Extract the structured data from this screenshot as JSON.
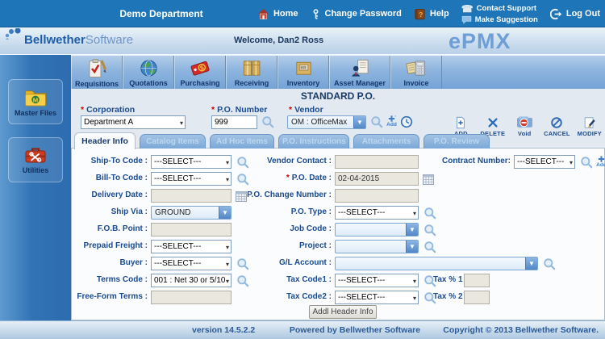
{
  "topbar": {
    "department": "Demo Department",
    "home": "Home",
    "change_password": "Change Password",
    "help": "Help",
    "contact_support": "Contact Support",
    "make_suggestion": "Make Suggestion",
    "log_out": "Log Out"
  },
  "welcome_bar": {
    "brand_bold": "Bellwether",
    "brand_light": "Software",
    "welcome": "Welcome, Dan2 Ross",
    "product": "ePMX"
  },
  "toolbar": {
    "items": [
      {
        "label": "Requisitions",
        "icon": "requisitions-icon"
      },
      {
        "label": "Quotations",
        "icon": "quotations-icon"
      },
      {
        "label": "Purchasing",
        "icon": "purchasing-icon"
      },
      {
        "label": "Receiving",
        "icon": "receiving-icon"
      },
      {
        "label": "Inventory",
        "icon": "inventory-icon"
      },
      {
        "label": "Asset Manager",
        "icon": "asset-manager-icon"
      },
      {
        "label": "Invoice",
        "icon": "invoice-icon"
      }
    ]
  },
  "sidebar": {
    "items": [
      {
        "label": "Master Files",
        "icon": "folder-icon"
      },
      {
        "label": "Utilities",
        "icon": "toolbox-icon"
      }
    ]
  },
  "po_header": {
    "title": "STANDARD P.O.",
    "corporation": {
      "req": "*",
      "label": "Corporation",
      "value": "Department A"
    },
    "po_number": {
      "req": "*",
      "label": "P.O. Number",
      "value": "999"
    },
    "vendor": {
      "req": "*",
      "label": "Vendor",
      "value": "OM : OfficeMax"
    },
    "actions": [
      {
        "label": "ADD"
      },
      {
        "label": "DELETE"
      },
      {
        "label": "Void"
      },
      {
        "label": "CANCEL"
      },
      {
        "label": "MODIFY"
      }
    ]
  },
  "icons": {
    "add_label": "Add"
  },
  "tabs": [
    "Header Info",
    "Catalog Items",
    "Ad Hoc Items",
    "P.O. Instructions",
    "Attachments",
    "P.O. Review"
  ],
  "form": {
    "left": [
      {
        "label": "Ship-To Code :",
        "value": "---SELECT---"
      },
      {
        "label": "Bill-To Code :",
        "value": "---SELECT---"
      },
      {
        "label": "Delivery Date :",
        "value": ""
      },
      {
        "label": "Ship Via :",
        "value": "GROUND"
      },
      {
        "label": "F.O.B. Point :",
        "value": ""
      },
      {
        "label": "Prepaid Freight :",
        "value": "---SELECT---"
      },
      {
        "label": "Buyer :",
        "value": "---SELECT---"
      },
      {
        "label": "Terms Code :",
        "value": "001 : Net 30 or 5/10"
      },
      {
        "label": "Free-Form Terms :",
        "value": ""
      }
    ],
    "middle": [
      {
        "label": "Vendor Contact :",
        "value": ""
      },
      {
        "req": "*",
        "label": "P.O. Date :",
        "value": "02-04-2015"
      },
      {
        "label": "P.O. Change Number :",
        "value": ""
      },
      {
        "label": "P.O. Type :",
        "value": "---SELECT---"
      },
      {
        "label": "Job Code :",
        "value": ""
      },
      {
        "label": "Project :",
        "value": ""
      },
      {
        "label": "G/L Account :",
        "value": ""
      },
      {
        "label": "Tax Code1 :",
        "value": "---SELECT---"
      },
      {
        "label": "Tax Code2 :",
        "value": "---SELECT---"
      }
    ],
    "right": {
      "contract_label": "Contract Number:",
      "contract_value": "---SELECT---",
      "tax1_label": "Tax % 1 :",
      "tax1_value": "",
      "tax2_label": "Tax % 2 :",
      "tax2_value": ""
    },
    "addl_button": "Addl Header Info"
  },
  "colors": {
    "accent_blue": "#1e76b8",
    "required_red": "#cc0000",
    "navy_text": "#1a4a8f"
  },
  "footer": {
    "version": "version 14.5.2.2",
    "powered": "Powered by Bellwether Software",
    "copyright": "Copyright © 2013 Bellwether Software."
  }
}
